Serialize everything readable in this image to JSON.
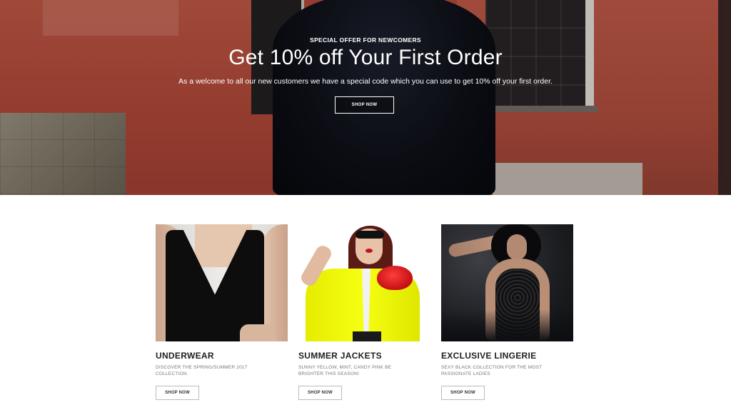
{
  "hero": {
    "eyebrow": "SPECIAL OFFER FOR NEWCOMERS",
    "title": "Get 10% off Your First Order",
    "description": "As a welcome to all our new customers we have a special code which you can use to get 10% off your first order.",
    "button_label": "SHOP NOW"
  },
  "cards": [
    {
      "title": "UNDERWEAR",
      "subtitle": "DISCOVER THE SPRING/SUMMER 2017 COLLECTION.",
      "button_label": "SHOP NOW"
    },
    {
      "title": "SUMMER JACKETS",
      "subtitle": "SUNNY YELLOW, MINT, CANDY PINK BE BRIGHTER THIS SEASON!",
      "button_label": "SHOP NOW"
    },
    {
      "title": "EXCLUSIVE LINGERIE",
      "subtitle": "SEXY BLACK COLLECTION FOR THE MOST PASSIONATE LADIES",
      "button_label": "SHOP NOW"
    }
  ],
  "colors": {
    "hero_wall": "#b44a3a",
    "text_dark": "#1f1f1f",
    "accent_yellow": "#f6ff12",
    "accent_red": "#c40f12"
  }
}
